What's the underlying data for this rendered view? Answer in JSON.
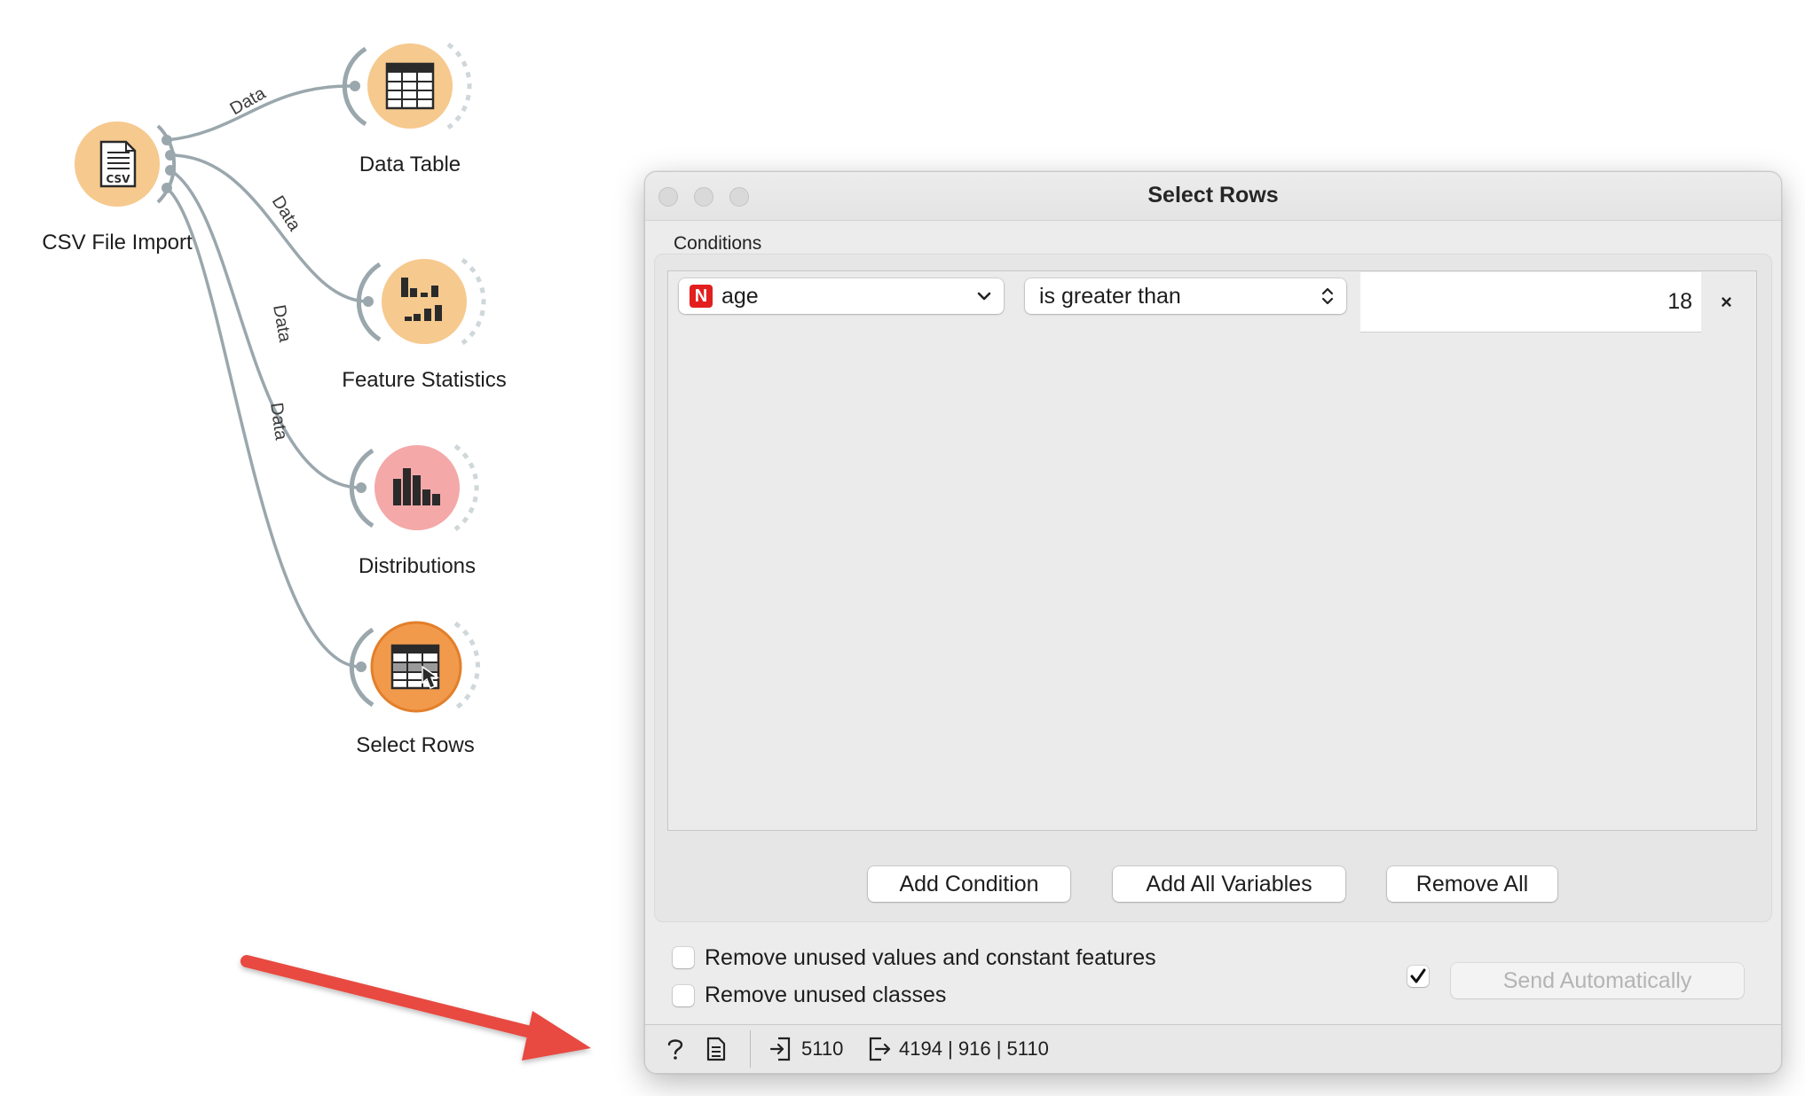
{
  "canvas": {
    "nodes": [
      {
        "id": "csv",
        "label": "CSV File Import"
      },
      {
        "id": "datatable",
        "label": "Data Table"
      },
      {
        "id": "featstats",
        "label": "Feature Statistics"
      },
      {
        "id": "distributions",
        "label": "Distributions"
      },
      {
        "id": "selectrows",
        "label": "Select Rows"
      }
    ],
    "link_label": "Data",
    "csv_icon_text": "CSV"
  },
  "dialog": {
    "title": "Select Rows",
    "conditions_label": "Conditions",
    "condition": {
      "variable_type_badge": "N",
      "variable": "age",
      "operator": "is greater than",
      "value": "18",
      "remove_symbol": "×"
    },
    "buttons": {
      "add_condition": "Add Condition",
      "add_all_variables": "Add All Variables",
      "remove_all": "Remove All"
    },
    "options": {
      "remove_unused_values": {
        "label": "Remove unused values and constant features",
        "checked": false
      },
      "remove_unused_classes": {
        "label": "Remove unused classes",
        "checked": false
      }
    },
    "send_automatically": {
      "label": "Send Automatically",
      "checked": true
    }
  },
  "statusbar": {
    "input_count": "5110",
    "output_summary": "4194 | 916 | 5110"
  },
  "colors": {
    "annotation_arrow": "#e8493f",
    "node_data": "#f6c98e",
    "node_visualize": "#f4a8a8",
    "node_transform": "#f29a4c",
    "link": "#9aa7ad"
  }
}
